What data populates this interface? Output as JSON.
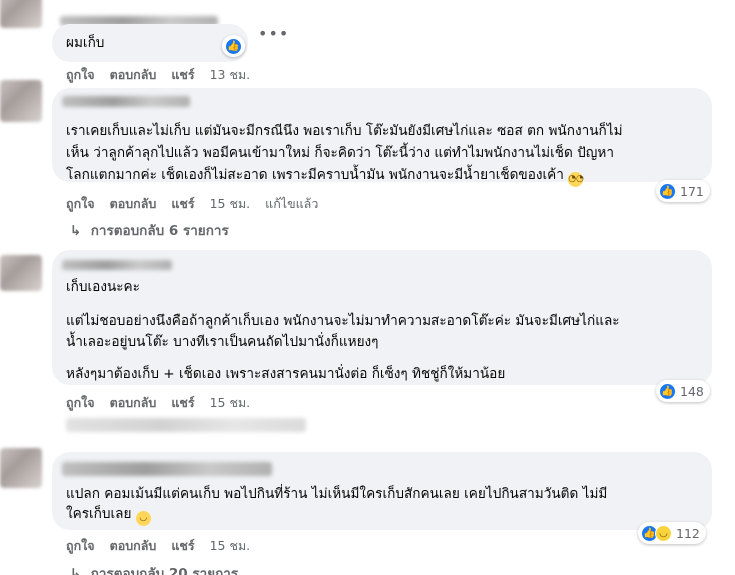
{
  "comments": [
    {
      "text_lines": [
        "ผมเก็บ"
      ],
      "actions": {
        "like": "ถูกใจ",
        "reply": "ตอบกลับ",
        "share": "แชร์",
        "time": "13 ชม."
      },
      "reaction_count": ""
    },
    {
      "text_lines": [
        "เราเคยเก็บและไม่เก็บ แต่มันจะมีกรณีนึง พอเราเก็บ โต๊ะมันยังมีเศษไก่และ ซอส ตก พนักงานก็ไม่",
        "เห็น ว่าลูกค้าลุกไปแล้ว พอมีคนเข้ามาใหม่ ก็จะคิดว่า โต๊ะนี้ว่าง แต่ทำไมพนักงานไม่เช็ด ปัญหา",
        "โลกแตกมากค่ะ เช็ดเองก็ไม่สะอาด เพราะมีคราบน้ำมัน พนักงานจะมีน้ำยาเช็ดของเค้า"
      ],
      "actions": {
        "like": "ถูกใจ",
        "reply": "ตอบกลับ",
        "share": "แชร์",
        "time": "15 ชม.",
        "edited": "แก้ไขแล้ว"
      },
      "reaction_count": "171",
      "replies_label": "การตอบกลับ 6 รายการ"
    },
    {
      "name_fragment": "Sandee Sandy",
      "text_lines": [
        "เก็บเองนะคะ",
        "แต่ไม่ชอบอย่างนึงคือถ้าลูกค้าเก็บเอง พนักงานจะไม่มาทำความสะอาดโต๊ะค่ะ มันจะมีเศษไก่และ",
        "น้ำเลอะอยู่บนโต๊ะ บางทีเราเป็นคนถัดไปมานั่งก็แหยงๆ",
        "หลังๆมาต้องเก็บ + เช็ดเอง เพราะสงสารคนมานั่งต่อ ก็เซ็งๆ ทิชชู่ก็ให้มาน้อย"
      ],
      "actions": {
        "like": "ถูกใจ",
        "reply": "ตอบกลับ",
        "share": "แชร์",
        "time": "15 ชม."
      },
      "reaction_count": "148"
    },
    {
      "text_lines": [
        "แปลก คอมเม้นมีแต่คนเก็บ พอไปกินที่ร้าน ไม่เห็นมีใครเก็บสักคนเลย เคยไปกินสามวันติด ไม่มี",
        "ใครเก็บเลย"
      ],
      "actions": {
        "like": "ถูกใจ",
        "reply": "ตอบกลับ",
        "share": "แชร์",
        "time": "15 ชม."
      },
      "reaction_count": "112",
      "replies_label": "การตอบกลับ 20 รายการ"
    }
  ],
  "icons": {
    "like": "like-icon",
    "haha": "haha-icon",
    "more": "more-options-icon",
    "reply_arrow": "reply-arrow-icon"
  },
  "colors": {
    "bubble": "#f0f2f5",
    "like_blue": "#1877f2",
    "muted": "#65676b",
    "text": "#050505"
  }
}
